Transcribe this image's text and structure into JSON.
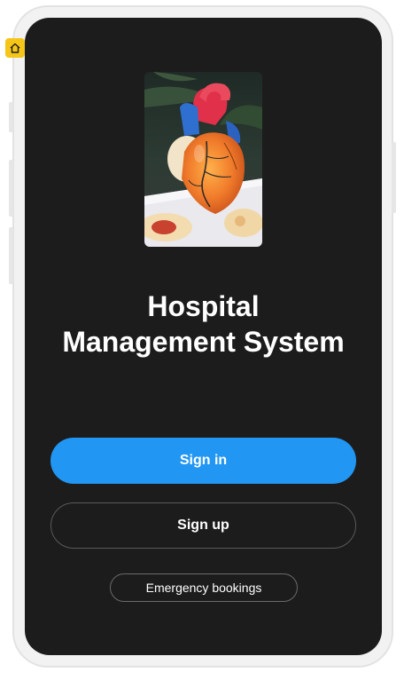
{
  "app": {
    "title_line1": "Hospital",
    "title_line2": "Management System"
  },
  "hero_image": {
    "icon": "anatomical-heart-model-image"
  },
  "actions": {
    "signin_label": "Sign in",
    "signup_label": "Sign up",
    "emergency_label": "Emergency bookings"
  },
  "colors": {
    "screen_bg": "#1c1c1c",
    "primary": "#2196f3",
    "home_badge": "#f5c518"
  },
  "overlay": {
    "home_icon": "home-icon"
  }
}
